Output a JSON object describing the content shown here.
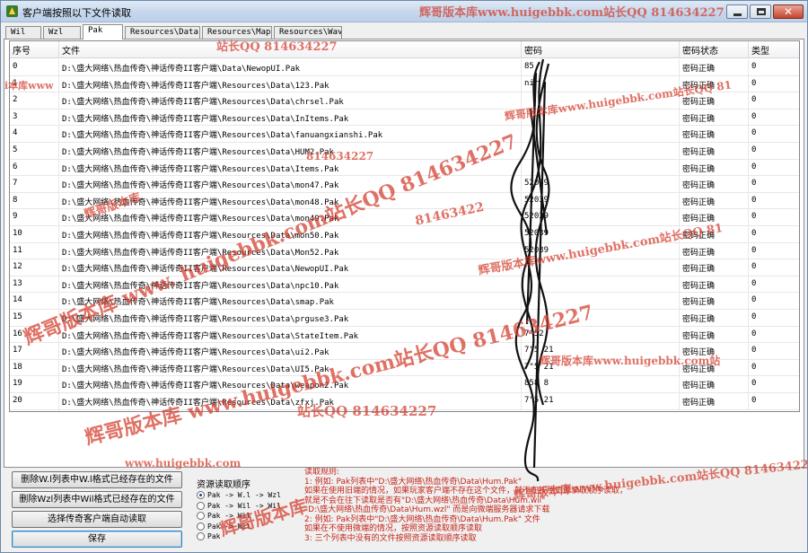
{
  "window": {
    "title": "客户端按照以下文件读取",
    "buttons": {
      "minimize": "",
      "maximize": "",
      "close": "✕"
    }
  },
  "tabs": [
    {
      "label": "Wil",
      "active": false
    },
    {
      "label": "Wzl",
      "active": false
    },
    {
      "label": "Pak",
      "active": true
    },
    {
      "label": "Resources\\Data",
      "active": false
    },
    {
      "label": "Resources\\Map",
      "active": false
    },
    {
      "label": "Resources\\Wav",
      "active": false
    }
  ],
  "table": {
    "columns": [
      "序号",
      "文件",
      "密码",
      "密码状态",
      "类型"
    ],
    "rows": [
      {
        "idx": "0",
        "file": "D:\\盛大网络\\热血传奇\\神话传奇II客户端\\Data\\NewopUI.Pak",
        "pwd": "85",
        "status": "密码正确",
        "type": "0"
      },
      {
        "idx": "1",
        "file": "D:\\盛大网络\\热血传奇\\神话传奇II客户端\\Resources\\Data\\123.Pak",
        "pwd": "       nir",
        "status": "密码正确",
        "type": "0"
      },
      {
        "idx": "2",
        "file": "D:\\盛大网络\\热血传奇\\神话传奇II客户端\\Resources\\Data\\chrsel.Pak",
        "pwd": "",
        "status": "密码正确",
        "type": "0"
      },
      {
        "idx": "3",
        "file": "D:\\盛大网络\\热血传奇\\神话传奇II客户端\\Resources\\Data\\InItems.Pak",
        "pwd": "",
        "status": "密码正确",
        "type": "0"
      },
      {
        "idx": "4",
        "file": "D:\\盛大网络\\热血传奇\\神话传奇II客户端\\Resources\\Data\\fanuangxianshi.Pak",
        "pwd": "",
        "status": "密码正确",
        "type": "0"
      },
      {
        "idx": "5",
        "file": "D:\\盛大网络\\热血传奇\\神话传奇II客户端\\Resources\\Data\\HUM2.Pak",
        "pwd": "",
        "status": "密码正确",
        "type": "0"
      },
      {
        "idx": "6",
        "file": "D:\\盛大网络\\热血传奇\\神话传奇II客户端\\Resources\\Data\\Items.Pak",
        "pwd": "",
        "status": "密码正确",
        "type": "0"
      },
      {
        "idx": "7",
        "file": "D:\\盛大网络\\热血传奇\\神话传奇II客户端\\Resources\\Data\\mon47.Pak",
        "pwd": "    52039",
        "status": "密码正确",
        "type": "0"
      },
      {
        "idx": "8",
        "file": "D:\\盛大网络\\热血传奇\\神话传奇II客户端\\Resources\\Data\\mon48.Pak",
        "pwd": "    52039",
        "status": "密码正确",
        "type": "0"
      },
      {
        "idx": "9",
        "file": "D:\\盛大网络\\热血传奇\\神话传奇II客户端\\Resources\\Data\\mon49.Pak",
        "pwd": "    52039",
        "status": "密码正确",
        "type": "0"
      },
      {
        "idx": "10",
        "file": "D:\\盛大网络\\热血传奇\\神话传奇II客户端\\Resources\\Data\\mon50.Pak",
        "pwd": "    52039",
        "status": "密码正确",
        "type": "0"
      },
      {
        "idx": "11",
        "file": "D:\\盛大网络\\热血传奇\\神话传奇II客户端\\Resources\\Data\\Mon52.Pak",
        "pwd": "    52039",
        "status": "密码正确",
        "type": "0"
      },
      {
        "idx": "12",
        "file": "D:\\盛大网络\\热血传奇\\神话传奇II客户端\\Resources\\Data\\NewopUI.Pak",
        "pwd": "",
        "status": "密码正确",
        "type": "0"
      },
      {
        "idx": "13",
        "file": "D:\\盛大网络\\热血传奇\\神话传奇II客户端\\Resources\\Data\\npc10.Pak",
        "pwd": "",
        "status": "密码正确",
        "type": "0"
      },
      {
        "idx": "14",
        "file": "D:\\盛大网络\\热血传奇\\神话传奇II客户端\\Resources\\Data\\smap.Pak",
        "pwd": "",
        "status": "密码正确",
        "type": "0"
      },
      {
        "idx": "15",
        "file": "D:\\盛大网络\\热血传奇\\神话传奇II客户端\\Resources\\Data\\prguse3.Pak",
        "pwd": "",
        "status": "密码正确",
        "type": "0"
      },
      {
        "idx": "16",
        "file": "D:\\盛大网络\\热血传奇\\神话传奇II客户端\\Resources\\Data\\StateItem.Pak",
        "pwd": "7\"52",
        "status": "密码正确",
        "type": "0"
      },
      {
        "idx": "17",
        "file": "D:\\盛大网络\\热血传奇\\神话传奇II客户端\\Resources\\Data\\ui2.Pak",
        "pwd": "7\"5   21",
        "status": "密码正确",
        "type": "0"
      },
      {
        "idx": "18",
        "file": "D:\\盛大网络\\热血传奇\\神话传奇II客户端\\Resources\\Data\\UI5.Pak",
        "pwd": "7\"5   21",
        "status": "密码正确",
        "type": "0"
      },
      {
        "idx": "19",
        "file": "D:\\盛大网络\\热血传奇\\神话传奇II客户端\\Resources\\Data\\weapon2.Pak",
        "pwd": "858   8",
        "status": "密码正确",
        "type": "0"
      },
      {
        "idx": "20",
        "file": "D:\\盛大网络\\热血传奇\\神话传奇II客户端\\Resources\\Data\\zfxj.Pak",
        "pwd": "7\"5   21",
        "status": "密码正确",
        "type": "0"
      }
    ]
  },
  "buttons": {
    "delete_wil": "删除W.l列表中W.l格式已经存在的文件",
    "delete_wzl": "删除Wzl列表中Wil格式已经存在的文件",
    "auto_read": "选择传奇客户端自动读取",
    "save": "保存"
  },
  "read_order": {
    "title": "资源读取顺序",
    "options": [
      {
        "label": "Pak -> W.l -> Wzl",
        "selected": true
      },
      {
        "label": "Pak -> Wil -> Wil",
        "selected": false
      },
      {
        "label": "Pak -> Wil",
        "selected": false
      },
      {
        "label": "Pak -> Wil",
        "selected": false
      },
      {
        "label": "Pak",
        "selected": false
      }
    ]
  },
  "rules": {
    "lines": [
      "读取规则:",
      "1: 例如: Pak列表中\"D:\\盛大网络\\热血传奇\\Data\\Hum.Pak\"",
      "   如果在使用旧端的情况，如果玩家客户端不存在这个文件，就不在按照资源读取顺序读取，",
      "   就是不会在往下读取是否有\"D:\\盛大网络\\热血传奇\\Data\\Hum.wil\"",
      "   \"D:\\盛大网络\\热血传奇\\Data\\Hum.wzl\"  而是向微端服务器请求下载",
      "2: 例如: Pak列表中\"D:\\盛大网络\\热血传奇\\Data\\Hum.Pak\"  文件",
      "   如果在不使用微端的情况，按照资源读取顺序读取",
      "3: 三个列表中没有的文件按照资源读取顺序读取"
    ]
  },
  "watermarks": {
    "site": "www.huigebbk.com",
    "red_a": "辉哥版本库www.huigebbk.com站长QQ 814634227",
    "red_b": "辉哥版本库",
    "qq": "站长QQ 814634227",
    "cn": "i本库www",
    "num": "814634227",
    "num_partial": "81463422",
    "red_c": "辉哥版本库www.huigebbk.com站长QQ 81",
    "red_d": "辉哥版本库www.huigebbk.com站",
    "red_e": "辉哥版本库 www. huigebbk.com站长QQ 814634227",
    "red_f": "辉哥版本库 www.huigebbk.com站长QQ 814634227",
    "red_g": "辉哥版本库www.huigebbk.com站长QQ 81",
    "red_h": "辉哥版本库"
  },
  "colors": {
    "watermark_red": "#d33b2b",
    "rules_red": "#c4261a",
    "titlebar": "#c6d7ec"
  },
  "icons": {
    "app": "app-icon",
    "minimize": "minimize-icon",
    "maximize": "maximize-icon",
    "close": "close-icon"
  }
}
